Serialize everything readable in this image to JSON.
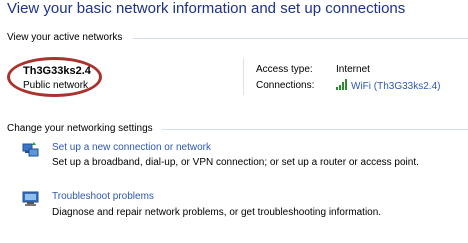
{
  "title": "View your basic network information and set up connections",
  "active_networks": {
    "header": "View your active networks",
    "network_name": "Th3G33ks2.4",
    "network_category": "Public network",
    "access_type_label": "Access type:",
    "access_type_value": "Internet",
    "connections_label": "Connections:",
    "connection_value": "WiFi (Th3G33ks2.4)",
    "connection_icon": "wifi-signal-icon"
  },
  "settings": {
    "header": "Change your networking settings",
    "tasks": [
      {
        "icon": "new-connection-icon",
        "link": "Set up a new connection or network",
        "description": "Set up a broadband, dial-up, or VPN connection; or set up a router or access point."
      },
      {
        "icon": "troubleshoot-icon",
        "link": "Troubleshoot problems",
        "description": "Diagnose and repair network problems, or get troubleshooting information."
      }
    ]
  },
  "colors": {
    "title": "#1e3287",
    "link": "#2f57b4",
    "highlight_circle": "#a9332c"
  }
}
